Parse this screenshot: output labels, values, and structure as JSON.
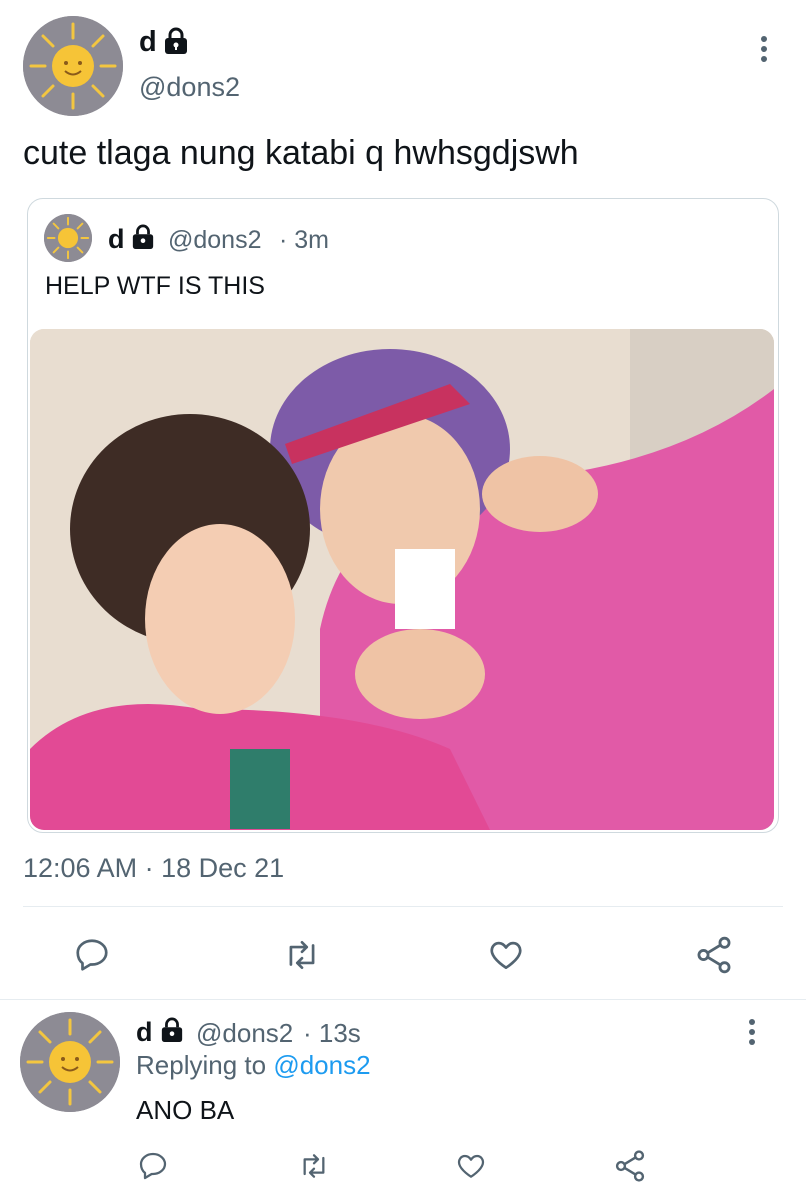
{
  "main_tweet": {
    "author_name": "d",
    "author_handle": "@dons2",
    "text": "cute tlaga nung katabi q hwhsgdjswh",
    "timestamp": "12:06 AM · 18 Dec 21",
    "icons": {
      "avatar": "sun-avatar",
      "lock": "lock-icon",
      "more": "more-vertical-icon"
    }
  },
  "quoted_tweet": {
    "author_name": "d",
    "author_handle": "@dons2",
    "time_ago": "· 3m",
    "text": "HELP WTF IS THIS"
  },
  "actions": [
    "reply-icon",
    "retweet-icon",
    "like-icon",
    "share-icon"
  ],
  "reply_tweet": {
    "author_name": "d",
    "author_handle": "@dons2",
    "time_ago": "· 13s",
    "replying_prefix": "Replying to",
    "replying_handle": "@dons2",
    "text": "ANO BA"
  },
  "colors": {
    "link": "#1d9bf0",
    "secondary_text": "#536471",
    "border": "#cfd9de"
  }
}
